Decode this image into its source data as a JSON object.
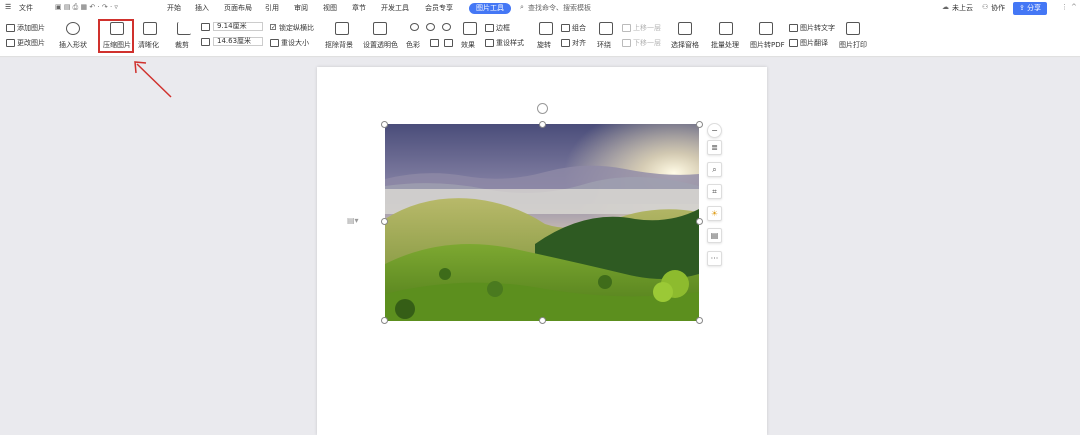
{
  "menubar": {
    "file_label": "文件",
    "tabs": [
      "开始",
      "插入",
      "页面布局",
      "引用",
      "审阅",
      "视图",
      "章节",
      "开发工具",
      "会员专享"
    ],
    "active_tab": "图片工具",
    "search_placeholder": "查找命令、搜索模板",
    "cloud_label": "未上云",
    "collab_label": "协作",
    "share_label": "分享"
  },
  "ribbon": {
    "add_image": "添加图片",
    "change_image": "更改图片",
    "insert_shape": "插入形状",
    "compress_image": "压缩图片",
    "clarity": "清晰化",
    "crop": "裁剪",
    "width_value": "9.14厘米",
    "height_value": "14.63厘米",
    "lock_ratio": "锁定纵横比",
    "reset_size": "重设大小",
    "matting": "抠除背景",
    "set_transparent": "设置透明色",
    "color": "色彩",
    "effects": "效果",
    "border": "边框",
    "reset_style": "重设样式",
    "rotate": "旋转",
    "combine": "组合",
    "align": "对齐",
    "wrap": "环绕",
    "move_up": "上移一层",
    "move_down": "下移一层",
    "select_pane": "选择窗格",
    "batch": "批量处理",
    "to_pdf": "图片转PDF",
    "to_text": "图片转文字",
    "translate": "图片翻译",
    "print": "图片打印"
  },
  "colors": {
    "accent": "#4477f5",
    "highlight": "#d0312d"
  }
}
